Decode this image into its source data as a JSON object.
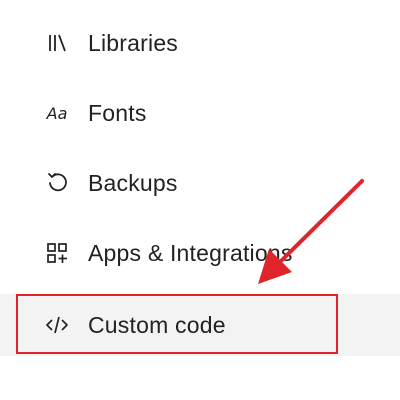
{
  "menu": {
    "items": [
      {
        "label": "Libraries",
        "icon": "libraries-icon"
      },
      {
        "label": "Fonts",
        "icon": "fonts-icon",
        "icon_text": "Aa"
      },
      {
        "label": "Backups",
        "icon": "backups-icon"
      },
      {
        "label": "Apps & Integrations",
        "icon": "apps-integrations-icon"
      },
      {
        "label": "Custom code",
        "icon": "code-icon",
        "selected": true
      }
    ]
  },
  "annotation": {
    "highlight_color": "#e0252a",
    "arrow_color": "#e0252a"
  },
  "colors": {
    "text": "#222222",
    "selected_background": "#f3f3f3",
    "background": "#ffffff"
  }
}
